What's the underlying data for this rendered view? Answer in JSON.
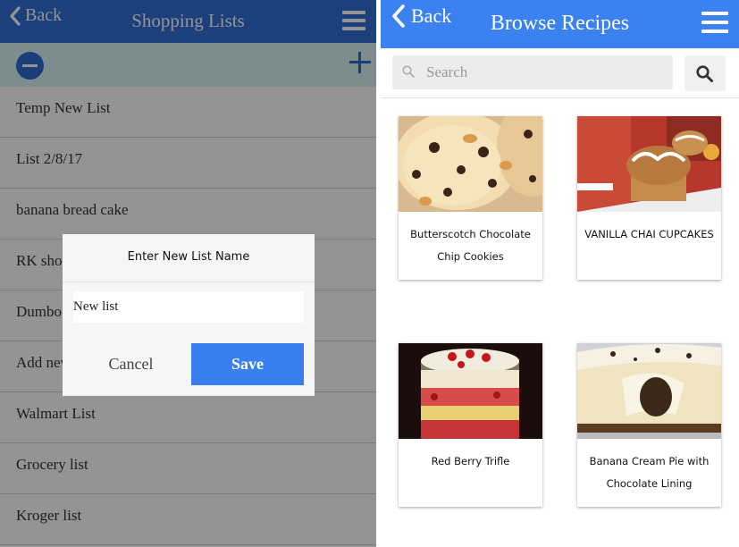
{
  "shopping": {
    "header": {
      "back": "Back",
      "title": "Shopping Lists"
    },
    "toolbar": {
      "remove_icon": "minus-circle-icon",
      "add_icon": "plus-icon"
    },
    "lists": [
      "Temp New List",
      "List 2/8/17",
      "banana bread cake",
      "RK shop",
      "Dumbo",
      "Add new",
      "Walmart List",
      "Grocery list",
      "Kroger list"
    ],
    "dialog": {
      "title": "Enter New List Name",
      "input_value": "New list",
      "cancel": "Cancel",
      "save": "Save"
    }
  },
  "recipes": {
    "header": {
      "back": "Back",
      "title": "Browse Recipes"
    },
    "search": {
      "placeholder": "Search"
    },
    "cards": [
      {
        "name": "Butterscotch Chocolate Chip Cookies"
      },
      {
        "name": "VANILLA CHAI CUPCAKES"
      },
      {
        "name": "Red Berry Trifle"
      },
      {
        "name": "Banana Cream Pie with Chocolate Lining"
      }
    ]
  },
  "colors": {
    "left_header": "#2f6fd6",
    "right_header": "#3b82f0",
    "save_button": "#3a7ff0",
    "toolbar_bg": "#d7f1f3"
  }
}
